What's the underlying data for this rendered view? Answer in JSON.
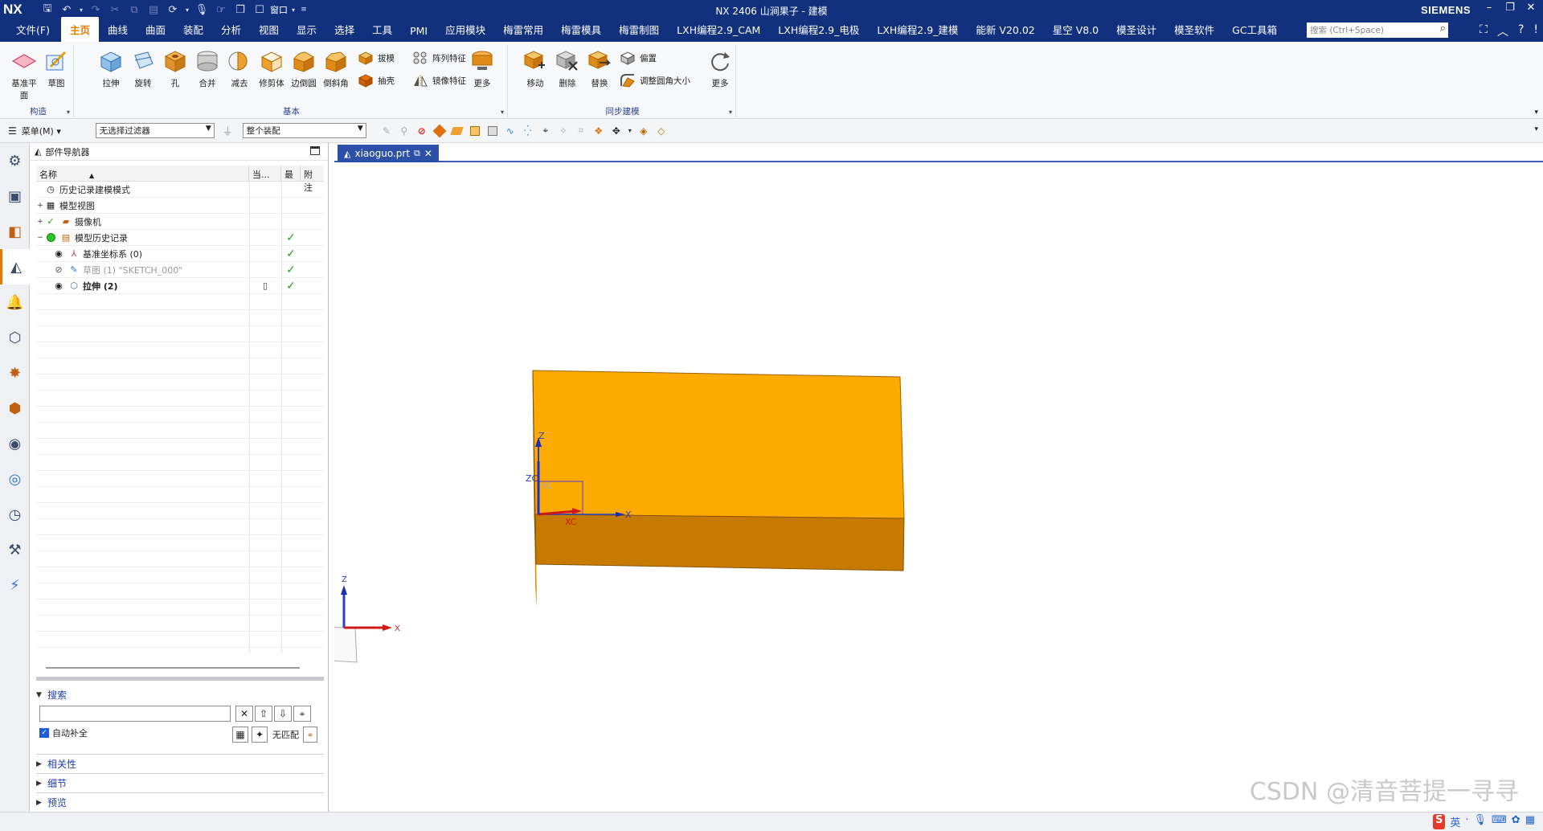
{
  "titlebar": {
    "logo": "NX",
    "title": "NX 2406 山涧果子 - 建模",
    "window_menu_label": "窗口",
    "brand": "SIEMENS"
  },
  "menubar": {
    "file": "文件(F)",
    "tabs": [
      "主页",
      "曲线",
      "曲面",
      "装配",
      "分析",
      "视图",
      "显示",
      "选择",
      "工具",
      "PMI",
      "应用模块",
      "梅雷常用",
      "梅雷模具",
      "梅雷制图",
      "LXH编程2.9_CAM",
      "LXH编程2.9_电极",
      "LXH编程2.9_建模",
      "能新 V20.02",
      "星空 V8.0",
      "模圣设计",
      "模圣软件",
      "GC工具箱"
    ],
    "active_tab": "主页",
    "search_placeholder": "搜索 (Ctrl+Space)"
  },
  "ribbon": {
    "groups": [
      {
        "label": "构造",
        "buttons": [
          "基准平面",
          "草图"
        ]
      },
      {
        "label": "基本",
        "buttons": [
          "拉伸",
          "旋转",
          "孔",
          "合并",
          "减去",
          "修剪体",
          "边倒圆",
          "倒斜角"
        ],
        "small": [
          "拔模",
          "抽壳",
          "阵列特征",
          "镜像特征"
        ],
        "more": "更多"
      },
      {
        "label": "同步建模",
        "buttons": [
          "移动",
          "删除",
          "替换"
        ],
        "small": [
          "偏置",
          "调整圆角大小"
        ],
        "more": "更多"
      }
    ]
  },
  "filterbar": {
    "menu": "菜单(M)",
    "filter": "无选择过滤器",
    "scope": "整个装配"
  },
  "navigator": {
    "title": "部件导航器",
    "columns": [
      "名称",
      "当...",
      "最",
      "附注"
    ],
    "rows": [
      {
        "label": "历史记录建模模式",
        "indent": 0,
        "expand": "",
        "check": ""
      },
      {
        "label": "模型视图",
        "indent": 0,
        "expand": "+",
        "check": ""
      },
      {
        "label": "摄像机",
        "indent": 0,
        "expand": "+",
        "check": ""
      },
      {
        "label": "模型历史记录",
        "indent": 0,
        "expand": "-",
        "check": "✓"
      },
      {
        "label": "基准坐标系 (0)",
        "indent": 1,
        "expand": "",
        "check": "✓"
      },
      {
        "label": "草图 (1) \"SKETCH_000\"",
        "indent": 1,
        "expand": "",
        "check": "✓"
      },
      {
        "label": "拉伸 (2)",
        "indent": 1,
        "expand": "",
        "check": "✓"
      }
    ],
    "search_label": "搜索",
    "autocomplete": "自动补全",
    "no_match": "无匹配",
    "sections": [
      "相关性",
      "细节",
      "预览"
    ]
  },
  "document": {
    "tab": "xiaoguo.prt"
  },
  "viewport": {
    "axis_labels": {
      "z": "Z",
      "x": "X",
      "zc": "ZC",
      "yc": "YC",
      "xc": "XC"
    },
    "part_top_color": "#ffaa00",
    "part_front_color": "#c77a00",
    "part_side_color": "#e08f00"
  },
  "watermark": "CSDN @清音菩提一寻寻"
}
